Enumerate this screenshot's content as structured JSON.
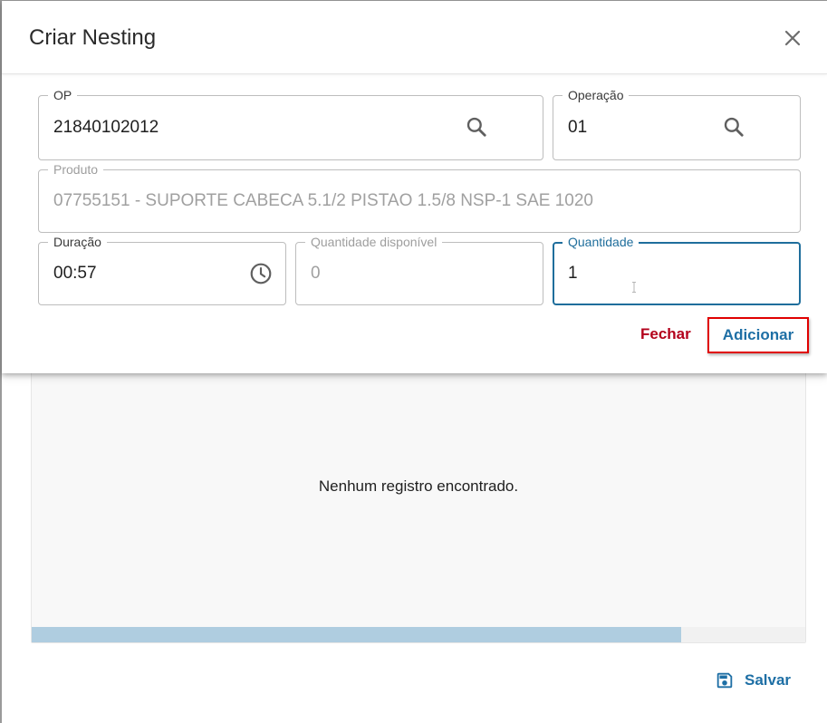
{
  "dialog": {
    "title": "Criar Nesting",
    "fields": {
      "op": {
        "label": "OP",
        "value": "21840102012"
      },
      "operacao": {
        "label": "Operação",
        "value": "01"
      },
      "produto": {
        "label": "Produto",
        "value": "07755151 - SUPORTE CABECA 5.1/2 PISTAO 1.5/8 NSP-1 SAE 1020"
      },
      "duracao": {
        "label": "Duração",
        "value": "00:57"
      },
      "quantidade_disponivel": {
        "label": "Quantidade disponível",
        "value": "0"
      },
      "quantidade": {
        "label": "Quantidade",
        "value": "1"
      }
    },
    "actions": {
      "fechar": "Fechar",
      "adicionar": "Adicionar"
    }
  },
  "page": {
    "table": {
      "empty_message": "Nenhum registro encontrado.",
      "scroll_position": 0.84
    },
    "save_label": "Salvar"
  },
  "colors": {
    "primary": "#1f6e9c",
    "danger": "#b3001b",
    "highlight_border": "#e00000"
  },
  "icons": [
    "close-icon",
    "search-icon",
    "clock-icon",
    "save-icon"
  ]
}
